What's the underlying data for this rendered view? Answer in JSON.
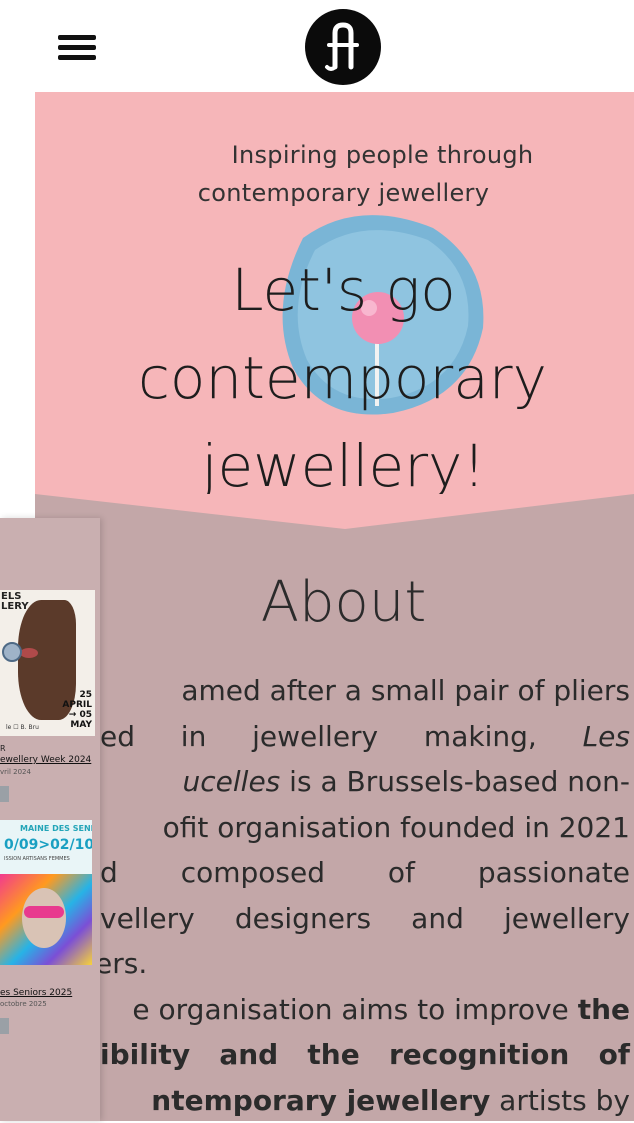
{
  "header": {
    "menu_icon": "hamburger-menu-icon",
    "logo_icon": "brand-logo-icon"
  },
  "hero": {
    "tagline_line1": "Inspiring people through",
    "tagline_line2": "contemporary jewellery",
    "title_line1": "Let's go",
    "title_line2": "contemporary",
    "title_line3": "jewellery!",
    "background_color": "#f6b6b9"
  },
  "about": {
    "title": "About",
    "background_color": "#c3a7a8",
    "lines": {
      "l1": "amed after a small pair of pliers",
      "l2a": "ed",
      "l2b": "in",
      "l2c": "jewellery",
      "l2d": "making,",
      "l2e": "Les",
      "l3a": "ucelles",
      "l3b": " is a Brussels-based non-",
      "l4": "ofit organisation founded in 2021",
      "l5a": "d",
      "l5b": "composed",
      "l5c": "of",
      "l5d": "passionate",
      "l6a": "vellery",
      "l6b": "designers",
      "l6c": "and",
      "l6d": "jewellery",
      "l7": "ers.",
      "l8a": "e organisation aims to improve ",
      "l8b": "the",
      "l9a": "ibility",
      "l9b": "and",
      "l9c": "the",
      "l9d": "recognition",
      "l9e": "of",
      "l10a": "ntemporary jewellery",
      "l10b": " artists by"
    }
  },
  "side_panel": {
    "card1": {
      "poster_title": "ELS\nLERY",
      "poster_date": "25\nAPRIL\n→ 05\nMAY",
      "poster_footer": "le ☐ B. Bru",
      "category": "R",
      "title": "ewellery Week 2024",
      "date": "vril 2024"
    },
    "card2": {
      "poster_top": "MAINE DES SENIORS",
      "poster_dates": "0/09>02/10",
      "poster_sub": "ISSION ARTISANS FEMMES",
      "title": "es Seniors 2025",
      "date": "octobre 2025"
    }
  }
}
